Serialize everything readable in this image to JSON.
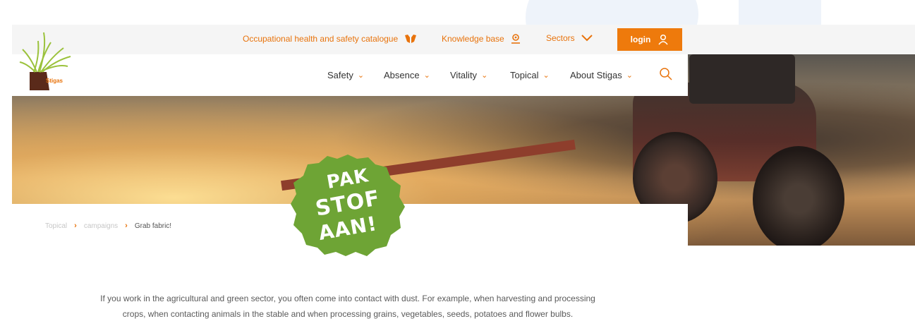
{
  "topbar": {
    "catalogue_label": "Occupational health and safety catalogue",
    "knowledge_label": "Knowledge base",
    "sectors_label": "Sectors",
    "login_label": "login"
  },
  "logo": {
    "text": "Stigas"
  },
  "nav": {
    "items": [
      {
        "label": "Safety"
      },
      {
        "label": "Absence"
      },
      {
        "label": "Vitality"
      },
      {
        "label": "Topical"
      },
      {
        "label": "About Stigas"
      }
    ]
  },
  "breadcrumb": {
    "items": [
      "Topical",
      "campaigns"
    ],
    "current": "Grab fabric!"
  },
  "badge": {
    "line1": "PAK",
    "line2": "STOF",
    "line3": "AAN!"
  },
  "intro": {
    "text": "If you work in the agricultural and green sector, you often come into contact with dust. For example, when harvesting and processing crops, when contacting animals in the stable and when processing grains, vegetables, seeds, potatoes and flower bulbs."
  },
  "colors": {
    "accent": "#ee7a0c",
    "badge": "#6ea435"
  }
}
